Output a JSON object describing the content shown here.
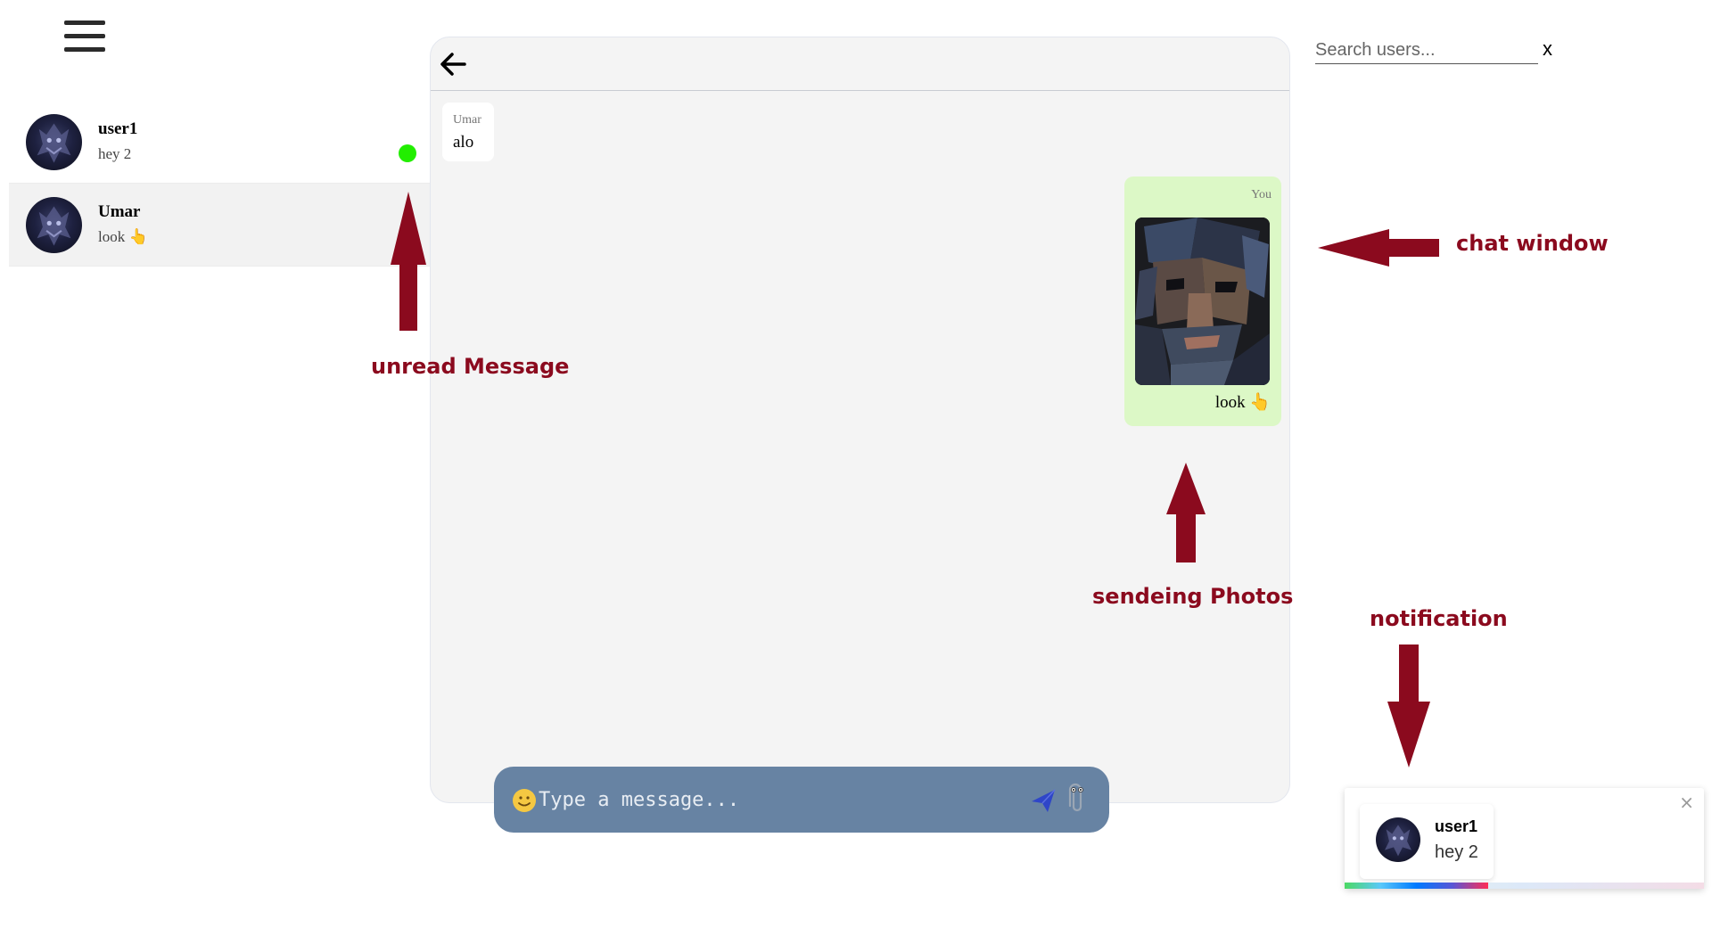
{
  "sidebar": {
    "contacts": [
      {
        "name": "user1",
        "preview": "hey 2",
        "unread": true
      },
      {
        "name": "Umar",
        "preview": "look 👆",
        "unread": false,
        "active": true
      }
    ]
  },
  "chat": {
    "messages": [
      {
        "direction": "incoming",
        "sender": "Umar",
        "text": "alo"
      },
      {
        "direction": "outgoing",
        "sender": "You",
        "text": "look 👆",
        "has_photo": true
      }
    ],
    "input": {
      "placeholder": "Type a message...",
      "value": ""
    }
  },
  "search": {
    "placeholder": "Search users...",
    "clear_label": "x"
  },
  "annotations": {
    "unread": "unread Message",
    "chat_window": "chat window",
    "photos": "sendeing Photos",
    "notification": "notification"
  },
  "notification": {
    "name": "user1",
    "message": "hey 2",
    "close_label": "×",
    "progress": 0.4
  },
  "colors": {
    "annotation": "#8b0a1e",
    "unread_dot": "#22ee00",
    "outgoing_bubble": "#dcf8c6",
    "input_bar": "#6783a3",
    "chat_bg": "#f4f4f4"
  },
  "icons": [
    "hamburger-menu-icon",
    "back-arrow-icon",
    "emoji-icon",
    "send-icon",
    "paperclip-icon",
    "close-icon"
  ]
}
